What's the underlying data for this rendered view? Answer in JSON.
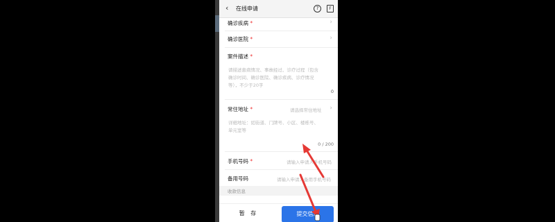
{
  "header": {
    "back_icon": "chevron-left",
    "title": "在线申请",
    "help_icon": "?",
    "doc_icon": "F"
  },
  "fields": {
    "diagnosis_disease": {
      "label": "确诊疾病",
      "required": "*"
    },
    "diagnosis_hospital": {
      "label": "确诊医院",
      "required": "*"
    },
    "case_description": {
      "label": "案件描述",
      "required": "*",
      "placeholder_lines": [
        "请描述患病情况、事故经过、诊疗过程（包含",
        "确诊时间、确诊医院、确诊疾病、诊疗情况",
        "等），不少于20字"
      ],
      "count": "0"
    },
    "address": {
      "label": "常住地址",
      "required": "*",
      "select_hint": "请选择常住地址",
      "detail_lines": [
        "详细地址：如街道、门牌号、小区、楼栋号、",
        "单元室等"
      ],
      "count": "0 / 200"
    },
    "phone": {
      "label": "手机号码",
      "required": "*",
      "placeholder": "请输入申请人手机号码"
    },
    "backup_phone": {
      "label": "备用号码",
      "placeholder": "请输入申请人备用手机号码"
    }
  },
  "section": {
    "payment_info": "收款信息"
  },
  "footer": {
    "save_label": "暂 存",
    "submit_label": "提交信息"
  },
  "colors": {
    "accent": "#2b74e8",
    "required": "#e33333",
    "annotation_arrow": "#e53935"
  }
}
